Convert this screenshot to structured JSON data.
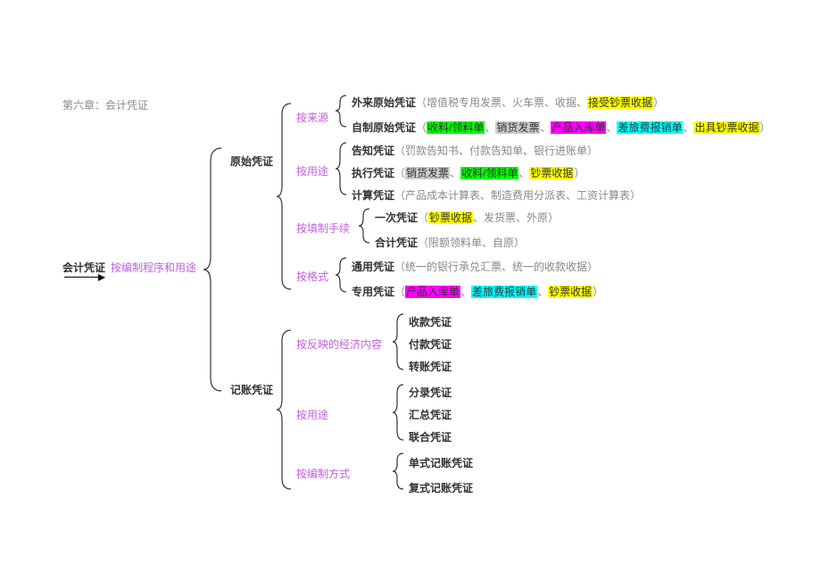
{
  "title": "第六章：会计凭证",
  "root": "会计凭证",
  "root_note": "按编制程序和用途",
  "b1": {
    "name": "原始凭证",
    "c1": {
      "label": "按来源",
      "r1": {
        "name": "外来原始凭证",
        "open": "（",
        "p1": "增值税专用发票、火车票、收据、",
        "h1": "接受钞票收据",
        "close": "）"
      },
      "r2": {
        "name": "自制原始凭证",
        "open": "（",
        "h1": "收料/领料单",
        "s1": "、",
        "h2": "销货发票",
        "s2": "、",
        "h3": "产品入库单",
        "s3": "、",
        "h4": "差旅费报销单",
        "s4": "、",
        "h5": "出具钞票收据",
        "close": "）"
      }
    },
    "c2": {
      "label": "按用途",
      "r1": {
        "name": "告知凭证",
        "note": "（罚款告知书、付款告知单、银行进账单）"
      },
      "r2": {
        "name": "执行凭证",
        "open": "（",
        "h1": "销货发票",
        "s1": "、",
        "h2": "收料/领料单",
        "s2": "、",
        "h3": "钞票收据",
        "close": "）"
      },
      "r3": {
        "name": "计算凭证",
        "note": "（产品成本计算表、制造费用分派表、工资计算表）"
      }
    },
    "c3": {
      "label": "按填制手续",
      "r1": {
        "name": "一次凭证",
        "open": "（",
        "h1": "钞票收据",
        "s1": "、发货票、外原",
        "close": "）"
      },
      "r2": {
        "name": "合计凭证",
        "note": "（限额领料单、自原）"
      }
    },
    "c4": {
      "label": "按格式",
      "r1": {
        "name": "通用凭证",
        "note": "（统一的银行承兑汇票、统一的收款收据）"
      },
      "r2": {
        "name": "专用凭证",
        "open": "（",
        "h1": "产品入库单",
        "s1": "、",
        "h2": "差旅费报销单",
        "s2": "、",
        "h3": "钞票收据",
        "close": "）"
      }
    }
  },
  "b2": {
    "name": "记账凭证",
    "c1": {
      "label": "按反映的经济内容",
      "r1": "收款凭证",
      "r2": "付款凭证",
      "r3": "转账凭证"
    },
    "c2": {
      "label": "按用途",
      "r1": "分录凭证",
      "r2": "汇总凭证",
      "r3": "联合凭证"
    },
    "c3": {
      "label": "按编制方式",
      "r1": "单式记账凭证",
      "r2": "复式记账凭证"
    }
  }
}
